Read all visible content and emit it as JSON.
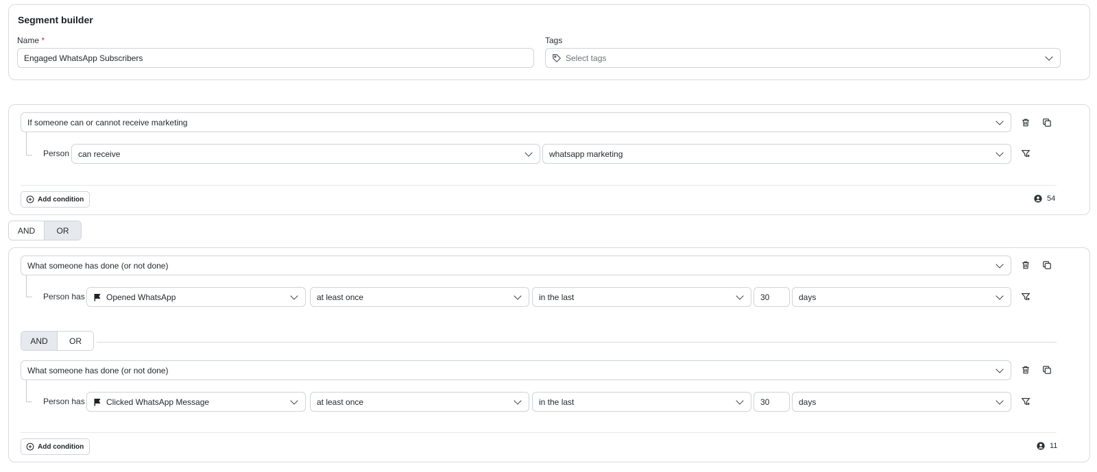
{
  "header": {
    "title": "Segment builder",
    "name_label": "Name",
    "required_mark": "*",
    "name_value": "Engaged WhatsApp Subscribers",
    "tags_label": "Tags",
    "tags_placeholder": "Select tags"
  },
  "group1": {
    "condition_type": "If someone can or cannot receive marketing",
    "row_label": "Person",
    "select_1": "can receive",
    "select_2": "whatsapp marketing",
    "add_condition_label": "Add condition",
    "count": "54"
  },
  "group_joiner": {
    "and": "AND",
    "or": "OR",
    "selected": "OR"
  },
  "group2": {
    "condition1": {
      "condition_type": "What someone has done (or not done)",
      "row_label": "Person has",
      "metric": "Opened WhatsApp",
      "frequency": "at least once",
      "timeframe": "in the last",
      "number": "30",
      "unit": "days"
    },
    "inner_joiner": {
      "and": "AND",
      "or": "OR",
      "selected": "AND"
    },
    "condition2": {
      "condition_type": "What someone has done (or not done)",
      "row_label": "Person has",
      "metric": "Clicked WhatsApp Message",
      "frequency": "at least once",
      "timeframe": "in the last",
      "number": "30",
      "unit": "days"
    },
    "add_condition_label": "Add condition",
    "count": "11"
  },
  "icons": [
    "tag-icon",
    "chevron-down-icon",
    "trash-icon",
    "copy-icon",
    "filter-icon",
    "plus-circle-icon",
    "user-circle-icon",
    "flag-icon"
  ]
}
